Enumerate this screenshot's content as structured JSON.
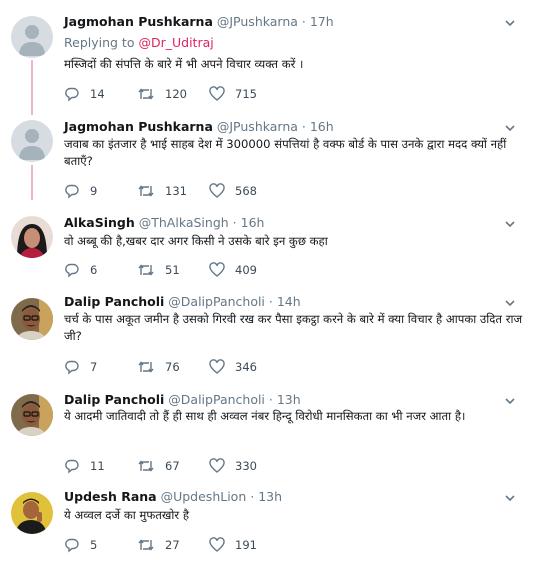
{
  "tweets": [
    {
      "name": "Jagmohan Pushkarna",
      "handle": "@JPushkarna",
      "time": "17h",
      "reply_prefix": "Replying to",
      "reply_to": "@Dr_Uditraj",
      "text": "मस्जिदों की संपत्ति के बारे में भी अपने विचार व्यक्त करें ।",
      "replies": "14",
      "retweets": "120",
      "likes": "715",
      "avatar": "default-avatar"
    },
    {
      "name": "Jagmohan Pushkarna",
      "handle": "@JPushkarna",
      "time": "16h",
      "text": "जवाब का इंतजार है भाई साहब देश में 300000 संपत्तियां है वक्फ बोर्ड के पास उनके द्वारा मदद क्यों नहीं बताएँ?",
      "replies": "9",
      "retweets": "131",
      "likes": "568",
      "avatar": "default-avatar"
    },
    {
      "name": "AlkaSingh",
      "handle": "@ThAlkaSingh",
      "time": "16h",
      "text": "वो अब्बू की है,खबर दार अगर किसी ने उसके बारे इन कुछ कहा",
      "replies": "6",
      "retweets": "51",
      "likes": "409",
      "avatar": "woman-photo"
    },
    {
      "name": "Dalip Pancholi",
      "handle": "@DalipPancholi",
      "time": "14h",
      "text": "चर्च के पास अकूत जमीन है उसको गिरवी रख कर पैसा इकट्ठा करने के बारे में क्या विचार है आपका उदित राज जी?",
      "replies": "7",
      "retweets": "76",
      "likes": "346",
      "avatar": "man-glasses-photo"
    },
    {
      "name": "Dalip Pancholi",
      "handle": "@DalipPancholi",
      "time": "13h",
      "text": "ये आदमी जातिवादी तो हैं ही साथ ही अव्वल नंबर हिन्दू विरोधी मानसिकता का भी नजर आता है।",
      "replies": "11",
      "retweets": "67",
      "likes": "330",
      "avatar": "man-glasses-photo"
    },
    {
      "name": "Updesh Rana",
      "handle": "@UpdeshLion",
      "time": "13h",
      "text": "ये अव्वल दर्जे का मुफतखोर है",
      "replies": "5",
      "retweets": "27",
      "likes": "191",
      "avatar": "man-yellow-photo"
    }
  ],
  "colors": {
    "thread_line": "#e9b9c4",
    "reply_link": "#e0245e",
    "meta_text": "#657786",
    "icon": "#657786"
  }
}
